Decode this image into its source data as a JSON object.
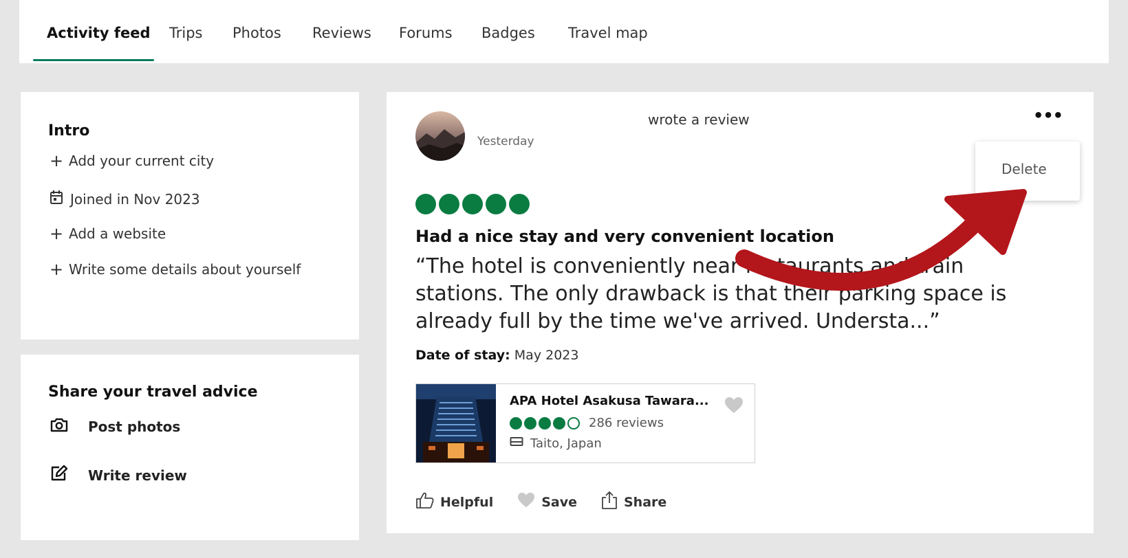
{
  "tabs": [
    {
      "label": "Activity feed",
      "active": true
    },
    {
      "label": "Trips"
    },
    {
      "label": "Photos"
    },
    {
      "label": "Reviews"
    },
    {
      "label": "Forums"
    },
    {
      "label": "Badges"
    },
    {
      "label": "Travel map"
    }
  ],
  "intro": {
    "heading": "Intro",
    "items": [
      {
        "icon": "plus-icon",
        "label": "Add your current city"
      },
      {
        "icon": "calendar-icon",
        "label": "Joined in Nov 2023"
      },
      {
        "icon": "plus-icon",
        "label": "Add a website"
      },
      {
        "icon": "plus-icon",
        "label": "Write some details about yourself"
      }
    ]
  },
  "advice": {
    "heading": "Share your travel advice",
    "items": [
      {
        "icon": "camera-icon",
        "label": "Post photos"
      },
      {
        "icon": "edit-icon",
        "label": "Write review"
      }
    ]
  },
  "review": {
    "action_text": "wrote a review",
    "time": "Yesterday",
    "more_label": "•••",
    "menu_delete": "Delete",
    "rating": 5,
    "title": "Had a nice stay and very convenient location",
    "text": "“The hotel is conveniently near restaurants and train stations. The only drawback is that their parking space is already full by the time we've arrived. Understa...”",
    "date_label": "Date of stay:",
    "date_value": "May 2023",
    "hotel": {
      "name": "APA Hotel Asakusa Tawara...",
      "rating": 4,
      "reviews": "286 reviews",
      "location": "Taito, Japan"
    },
    "actions": {
      "helpful": "Helpful",
      "save": "Save",
      "share": "Share"
    }
  },
  "colors": {
    "accent": "#0b7b5f",
    "bubble": "#0a7c42",
    "arrow": "#b3161b",
    "background": "#e6e6e6"
  }
}
